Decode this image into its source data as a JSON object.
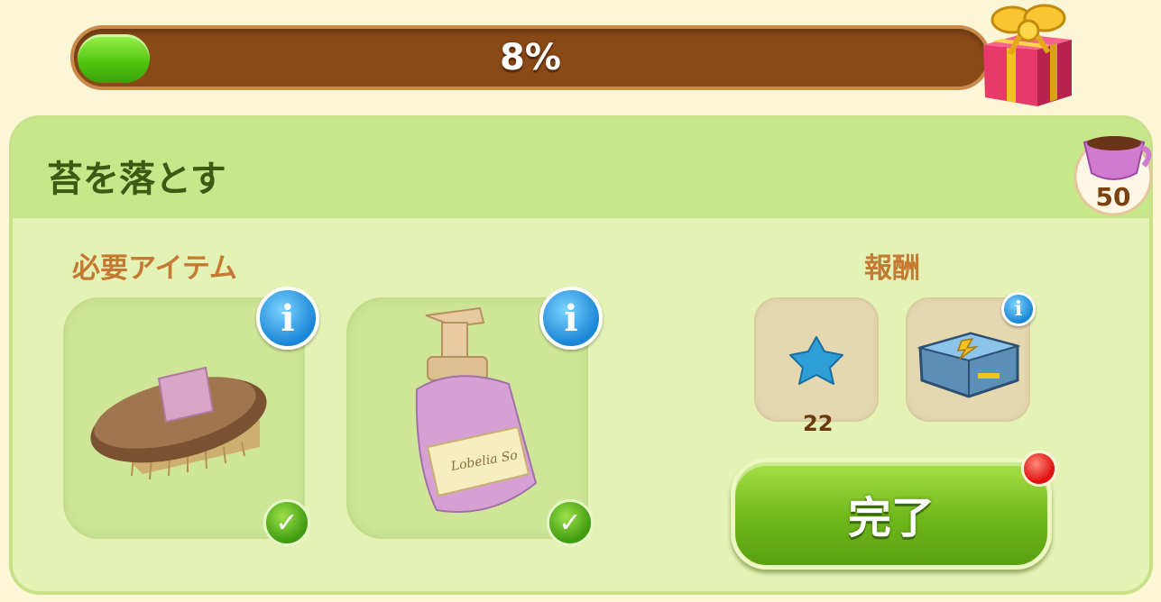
{
  "progress": {
    "value_percent": 8,
    "label": "8%"
  },
  "task": {
    "title": "苔を落とす"
  },
  "cost_badge": {
    "count": "50",
    "icon": "tea-cup-icon"
  },
  "required": {
    "label": "必要アイテム",
    "items": [
      {
        "icon": "scrub-brush-icon",
        "info_icon": "info-icon",
        "owned": true,
        "status_icon": "checkmark-icon"
      },
      {
        "icon": "soap-bottle-icon",
        "info_icon": "info-icon",
        "owned": true,
        "status_icon": "checkmark-icon"
      }
    ]
  },
  "rewards": {
    "label": "報酬",
    "items": [
      {
        "icon": "blue-star-icon",
        "count": "22"
      },
      {
        "icon": "energy-chest-icon",
        "info_icon": "info-icon"
      }
    ]
  },
  "done_button": {
    "label": "完了",
    "has_notification": true
  },
  "colors": {
    "accent_green": "#6fb81a",
    "bar_brown": "#8a4a17",
    "label_orange": "#c47a33"
  },
  "info_glyph": "i",
  "check_glyph": "✓"
}
